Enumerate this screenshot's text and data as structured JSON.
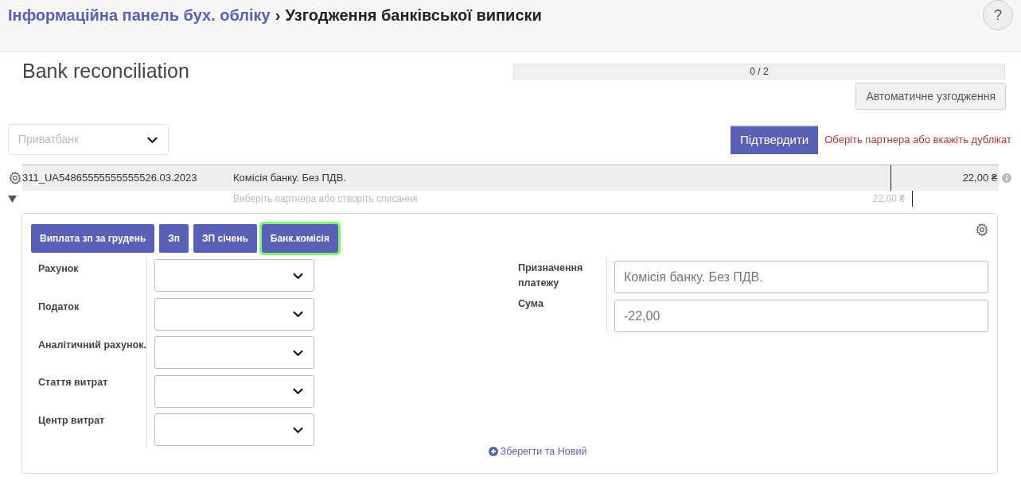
{
  "breadcrumb": {
    "parent": "Інформаційна панель бух. обліку",
    "separator": "›",
    "current": "Узгодження банківської виписки"
  },
  "help_button": "?",
  "title": "Bank reconciliation",
  "progress": {
    "label": "0 / 2",
    "level": 0
  },
  "auto_button": "Автоматичне узгодження",
  "journal": {
    "placeholder": "Приватбанк"
  },
  "validate_button": "Підтвердити",
  "notice": "Оберіть партнера або вкажіть дублікат",
  "line": {
    "reference": "311_UA54865555555555526.03.2023",
    "label": "Комісія банку. Без ПДВ.",
    "amount": "22,00 ₴",
    "hint": "Виберіть партнера або створіть списання",
    "open_amount": "22,00 ₴",
    "expanded": true
  },
  "models": [
    {
      "label": "Виплата зп за грудень",
      "selected": false
    },
    {
      "label": "Зп",
      "selected": false
    },
    {
      "label": "ЗП січень",
      "selected": false
    },
    {
      "label": "Банк.комісія",
      "selected": true
    }
  ],
  "left_fields": [
    {
      "label": "Рахунок"
    },
    {
      "label": "Податок"
    },
    {
      "label": "Аналітичний рахунок."
    },
    {
      "label": "Стаття витрат"
    },
    {
      "label": "Центр витрат"
    }
  ],
  "right_fields": [
    {
      "label": "Призначення платежу",
      "value": "Комісія банку. Без ПДВ."
    },
    {
      "label": "Сума",
      "value": "-22,00"
    }
  ],
  "save_link": "Зберегти та Новий"
}
